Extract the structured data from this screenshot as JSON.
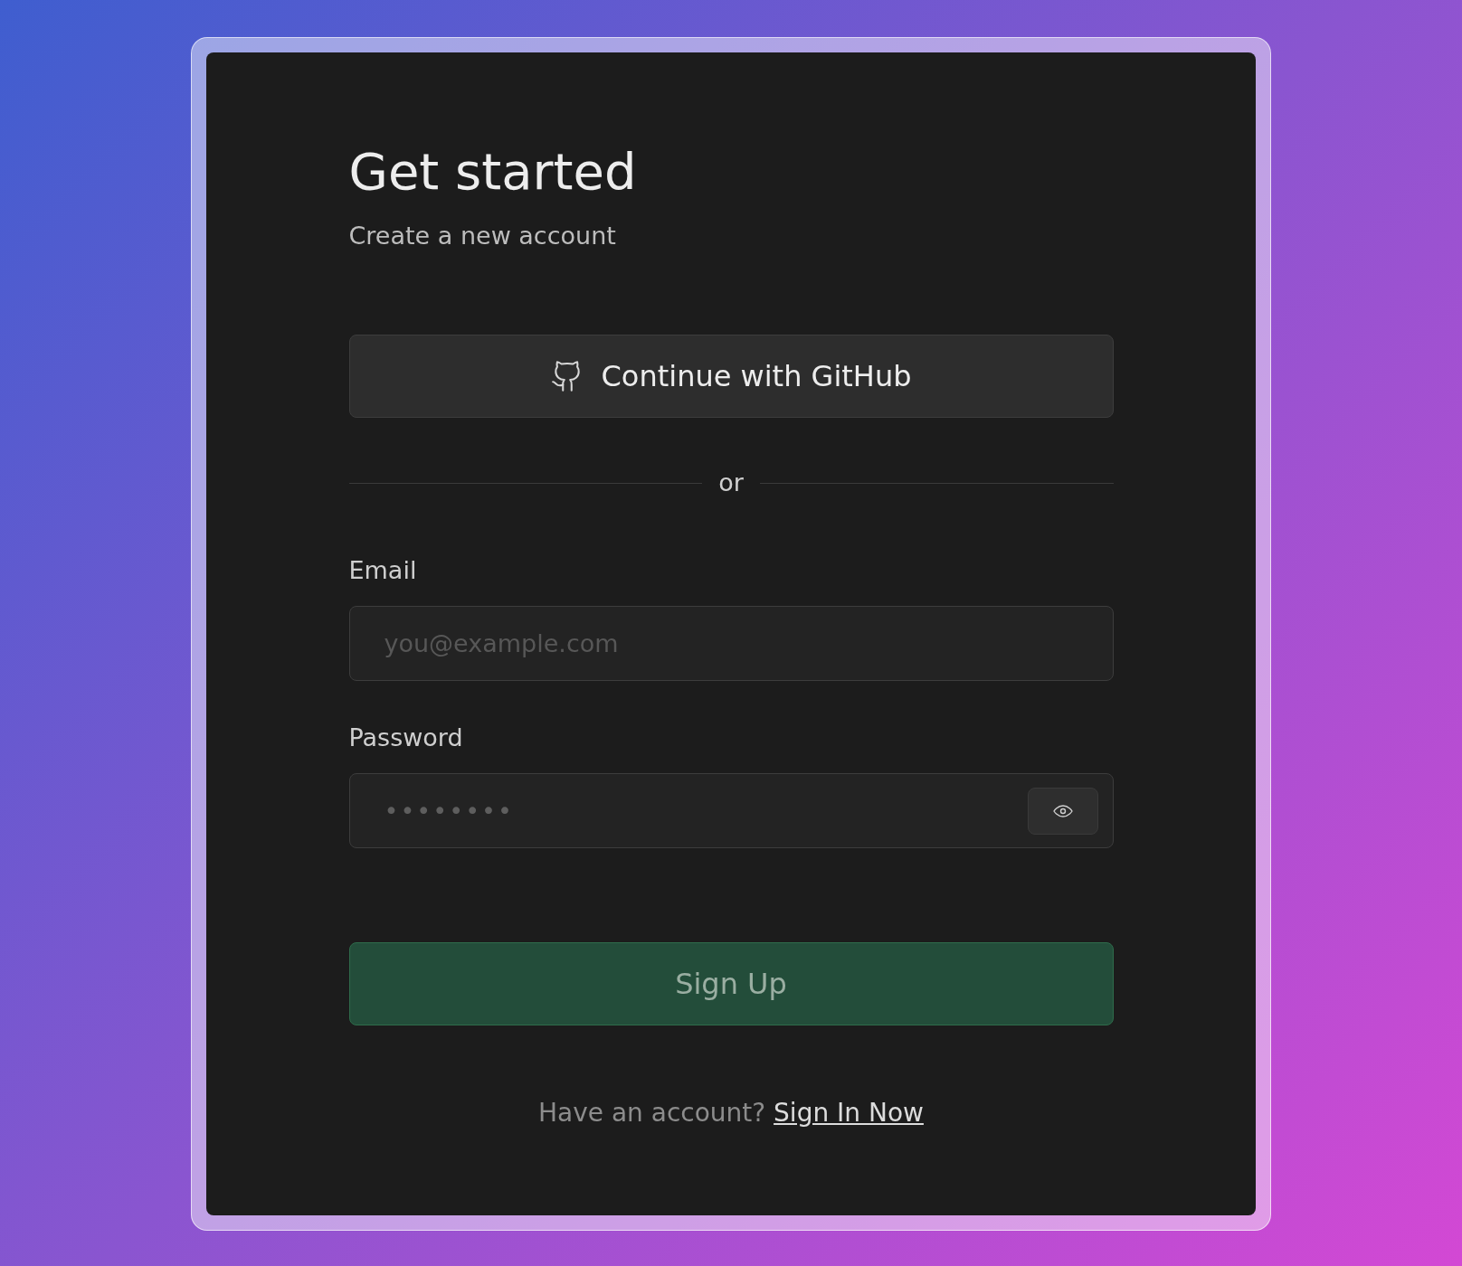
{
  "title": "Get started",
  "subtitle": "Create a new account",
  "oauth_button": {
    "label": "Continue with GitHub"
  },
  "divider": "or",
  "fields": [
    {
      "label": "Email",
      "placeholder": "you@example.com",
      "kind": "email"
    },
    {
      "label": "Password",
      "placeholder": "••••••••",
      "kind": "password"
    }
  ],
  "submit_button": "Sign Up",
  "footer": {
    "text": "Have an account?",
    "link": "Sign In Now"
  }
}
